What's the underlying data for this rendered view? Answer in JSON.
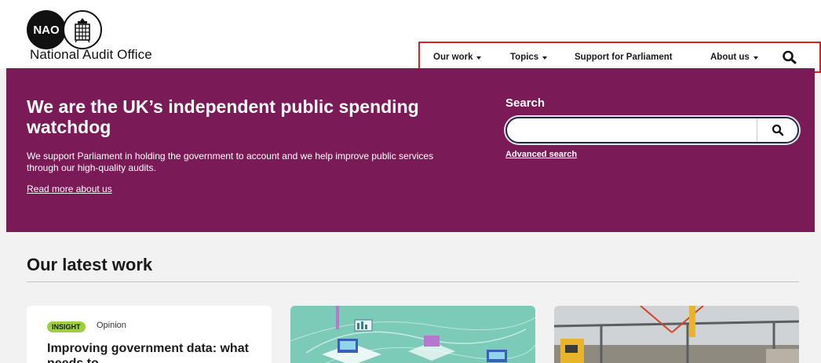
{
  "header": {
    "logo_short": "NAO",
    "logo_text": "National Audit Office"
  },
  "nav": {
    "items": [
      {
        "label": "Our work",
        "dropdown": true
      },
      {
        "label": "Topics",
        "dropdown": true
      },
      {
        "label": "Support for Parliament",
        "dropdown": false
      },
      {
        "label": "About us",
        "dropdown": true
      }
    ],
    "search_icon": "search-icon",
    "highlight_color": "#e0201f"
  },
  "hero": {
    "title": "We are the UK’s independent public spending watchdog",
    "description": "We support Parliament in holding the government to account and we help improve public services through our high-quality audits.",
    "read_more": "Read more about us",
    "background_color": "#7a1a56"
  },
  "search": {
    "label": "Search",
    "value": "",
    "placeholder": "",
    "button_icon": "search-icon",
    "advanced_link": "Advanced search"
  },
  "latest": {
    "title": "Our latest work",
    "cards": [
      {
        "tag": "INSIGHT",
        "type": "Opinion",
        "title": "Improving government data: what needs to"
      },
      {
        "image": "data-servers-illustration"
      },
      {
        "image": "construction-site-photo"
      }
    ],
    "tag_color": "#9fce3f"
  }
}
